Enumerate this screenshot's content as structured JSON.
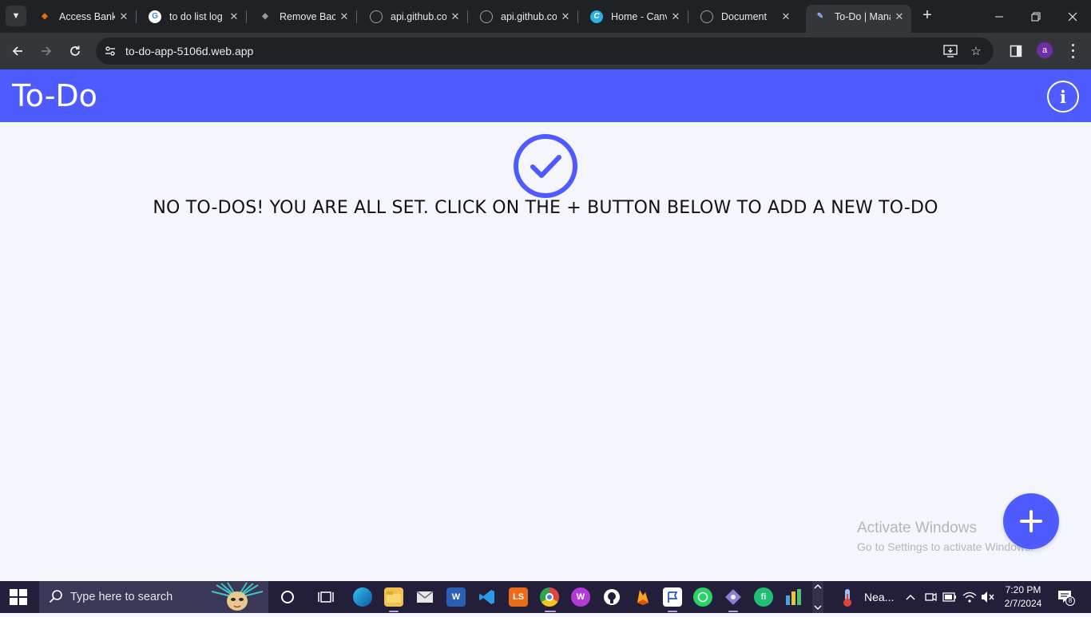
{
  "browser": {
    "tabs": [
      {
        "title": "Access Bank",
        "icon": "access-bank-icon",
        "color": "#e36c1b"
      },
      {
        "title": "to do list log",
        "icon": "google-icon",
        "color": "#4285f4"
      },
      {
        "title": "Remove Back",
        "icon": "layers-icon",
        "color": "#9aa0a6"
      },
      {
        "title": "api.github.co",
        "icon": "globe-icon",
        "color": "#9aa0a6"
      },
      {
        "title": "api.github.co",
        "icon": "globe-icon",
        "color": "#9aa0a6"
      },
      {
        "title": "Home - Canv",
        "icon": "canva-icon",
        "color": "#2ab1e3"
      },
      {
        "title": "Document",
        "icon": "globe-icon",
        "color": "#9aa0a6"
      },
      {
        "title": "To-Do | Mana",
        "icon": "todo-pencil-icon",
        "color": "#8ab4f8",
        "active": true
      }
    ],
    "url": "to-do-app-5106d.web.app",
    "profile_initial": "a"
  },
  "app": {
    "title": "To-Do",
    "empty_message": "NO TO-DOS! YOU ARE ALL SET. CLICK ON THE + BUTTON BELOW TO ADD A NEW TO-DO",
    "accent_color": "#4d5bff"
  },
  "watermark": {
    "line1": "Activate Windows",
    "line2": "Go to Settings to activate Windows."
  },
  "taskbar": {
    "search_placeholder": "Type here to search",
    "weather_text": "Nea...",
    "time": "7:20 PM",
    "date": "2/7/2024",
    "notification_count": "8",
    "apps": [
      {
        "name": "cortana-icon"
      },
      {
        "name": "task-view-icon"
      },
      {
        "name": "edge-icon",
        "color": "#1fa3d8"
      },
      {
        "name": "file-explorer-icon",
        "color": "#f2c14b"
      },
      {
        "name": "mail-icon",
        "color": "#e8e8e8"
      },
      {
        "name": "word-icon",
        "color": "#2b5fb4"
      },
      {
        "name": "vscode-icon",
        "color": "#2a9be7"
      },
      {
        "name": "ls-app-icon",
        "color": "#ec6b1a"
      },
      {
        "name": "chrome-icon",
        "color": "#e2453c"
      },
      {
        "name": "wps-icon",
        "color": "#b43ad6"
      },
      {
        "name": "github-desktop-icon",
        "color": "#ffffff"
      },
      {
        "name": "firebase-icon",
        "color": "#f5a623"
      },
      {
        "name": "flag-app-icon",
        "color": "#ffffff"
      },
      {
        "name": "whatsapp-icon",
        "color": "#25d366"
      },
      {
        "name": "git-icon",
        "color": "#8d7fd4"
      },
      {
        "name": "fiverr-icon",
        "color": "#1dbf73"
      },
      {
        "name": "chart-app-icon",
        "color": "#e9c33a"
      }
    ]
  }
}
